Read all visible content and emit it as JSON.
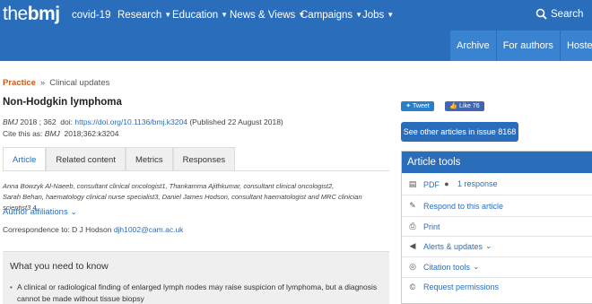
{
  "header": {
    "logo_the": "the",
    "logo_bmj": "bmj",
    "nav": [
      {
        "label": "covid-19",
        "caret": false
      },
      {
        "label": "Research",
        "caret": true
      },
      {
        "label": "Education",
        "caret": true
      },
      {
        "label": "News & Views",
        "caret": true
      },
      {
        "label": "Campaigns",
        "caret": true
      },
      {
        "label": "Jobs",
        "caret": true
      }
    ],
    "search_label": "Search",
    "subnav": [
      "Archive",
      "For authors",
      "Hosted"
    ]
  },
  "breadcrumb": {
    "section": "Practice",
    "sep": "»",
    "sub": "Clinical updates"
  },
  "article": {
    "title": "Non-Hodgkin lymphoma",
    "journal": "BMJ",
    "year_vol": "2018 ; 362",
    "doi_label": "doi:",
    "doi": "https://doi.org/10.1136/bmj.k3204",
    "published": "(Published 22 August 2018)",
    "cite_prefix": "Cite this as:",
    "cite_journal": "BMJ",
    "cite_rest": "2018;362:k3204",
    "tabs": [
      "Article",
      "Related content",
      "Metrics",
      "Responses"
    ],
    "authors_line1": "Anna Bowzyk Al-Naeeb, consultant clinical oncologist1,  Thankamma Ajithkumar, consultant clinical oncologist2,",
    "authors_line2": "Sarah Behan, haematology clinical nurse specialist3,  Daniel James Hodson, consultant haematologist and MRC clinician scientist3 4",
    "affiliations": "Author affiliations",
    "corr_prefix": "Correspondence to: D J Hodson",
    "corr_email": "djh1002@cam.ac.uk",
    "box_heading": "What you need to know",
    "box_bullet": "•",
    "box_text": "A clinical or radiological finding of enlarged lymph nodes may raise suspicion of lymphoma, but a diagnosis cannot be made without tissue biopsy"
  },
  "sidebar": {
    "tweet": "Tweet",
    "like": "Like 76",
    "issue_button": "See other articles in issue 8168",
    "tools_title": "Article tools",
    "pdf": "PDF",
    "responses": "1 response",
    "respond": "Respond to this article",
    "print": "Print",
    "alerts": "Alerts & updates",
    "citation": "Citation tools",
    "permissions": "Request permissions",
    "caret": "⌄"
  }
}
